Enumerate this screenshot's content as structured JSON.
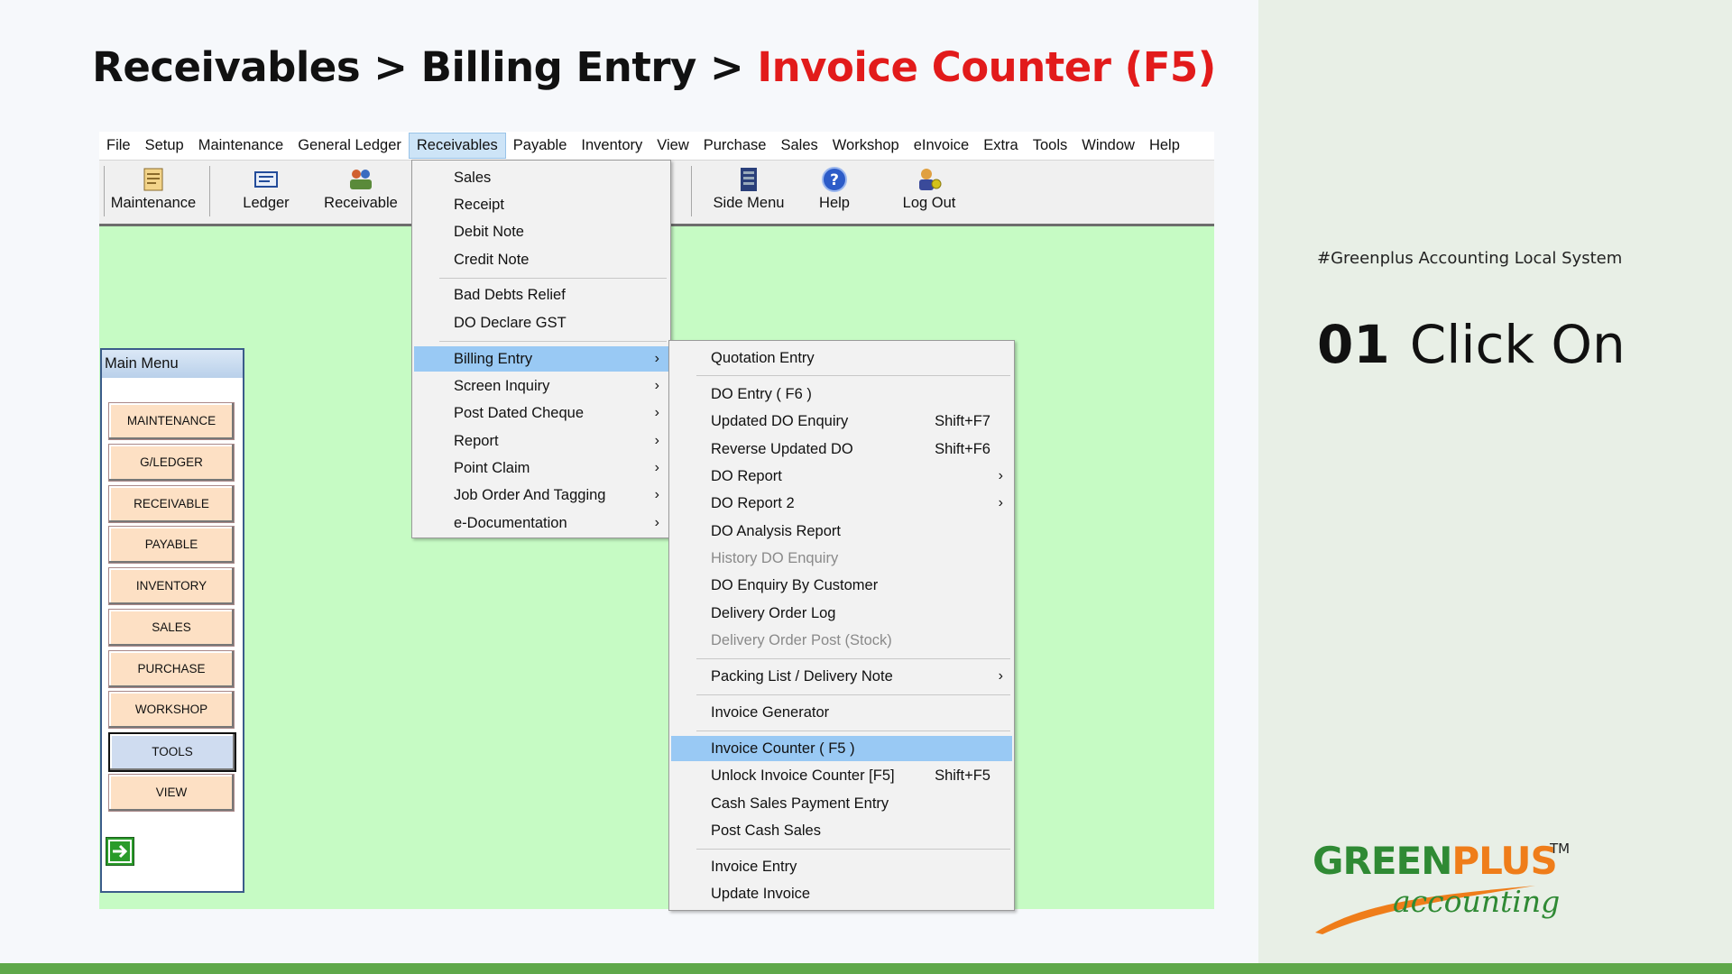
{
  "slide": {
    "title_prefix": "Receivables > Billing Entry > ",
    "title_highlight": "Invoice Counter (F5)",
    "hashtag": "#Greenplus Accounting Local System",
    "step_number": "01",
    "step_text": "Click On",
    "colors": {
      "highlight": "#e21b1b",
      "brand_green": "#2f8a34",
      "brand_orange": "#ef7d1a"
    }
  },
  "logo": {
    "word_green": "GREEN",
    "word_plus": "PLUS",
    "tm": "TM",
    "sub": "accounting"
  },
  "menubar": [
    "File",
    "Setup",
    "Maintenance",
    "General Ledger",
    "Receivables",
    "Payable",
    "Inventory",
    "View",
    "Purchase",
    "Sales",
    "Workshop",
    "eInvoice",
    "Extra",
    "Tools",
    "Window",
    "Help"
  ],
  "menubar_active": "Receivables",
  "toolbar": {
    "maintenance": "Maintenance",
    "ledger": "Ledger",
    "receivable": "Receivable",
    "side_menu": "Side Menu",
    "help": "Help",
    "log_out": "Log Out"
  },
  "main_menu": {
    "title": "Main Menu",
    "buttons": [
      "MAINTENANCE",
      "G/LEDGER",
      "RECEIVABLE",
      "PAYABLE",
      "INVENTORY",
      "SALES",
      "PURCHASE",
      "WORKSHOP",
      "TOOLS",
      "VIEW"
    ],
    "selected": "TOOLS"
  },
  "receivables_menu": {
    "items": [
      "Sales",
      "Receipt",
      "Debit Note",
      "Credit Note",
      "Bad Debts Relief",
      "DO Declare GST",
      "Billing Entry",
      "Screen Inquiry",
      "Post Dated Cheque",
      "Report",
      "Point Claim",
      "Job Order And Tagging",
      "e-Documentation"
    ],
    "highlighted": "Billing Entry"
  },
  "billing_menu": {
    "items": [
      {
        "label": "Quotation Entry"
      },
      {
        "label": "DO Entry  ( F6 )"
      },
      {
        "label": "Updated DO Enquiry",
        "shortcut": "Shift+F7"
      },
      {
        "label": "Reverse Updated DO",
        "shortcut": "Shift+F6"
      },
      {
        "label": "DO Report"
      },
      {
        "label": "DO Report 2"
      },
      {
        "label": "DO Analysis Report"
      },
      {
        "label": "History DO Enquiry"
      },
      {
        "label": "DO Enquiry By Customer"
      },
      {
        "label": "Delivery Order Log"
      },
      {
        "label": "Delivery Order Post (Stock)"
      },
      {
        "label": "Packing List / Delivery Note"
      },
      {
        "label": "Invoice Generator"
      },
      {
        "label": "Invoice Counter   ( F5 )"
      },
      {
        "label": "Unlock Invoice Counter [F5]",
        "shortcut": "Shift+F5"
      },
      {
        "label": "Cash Sales Payment Entry"
      },
      {
        "label": "Post Cash Sales"
      },
      {
        "label": "Invoice Entry"
      },
      {
        "label": "Update Invoice"
      }
    ],
    "highlighted": "Invoice Counter   ( F5 )",
    "disabled": [
      "History DO Enquiry",
      "Delivery Order Post (Stock)"
    ]
  }
}
